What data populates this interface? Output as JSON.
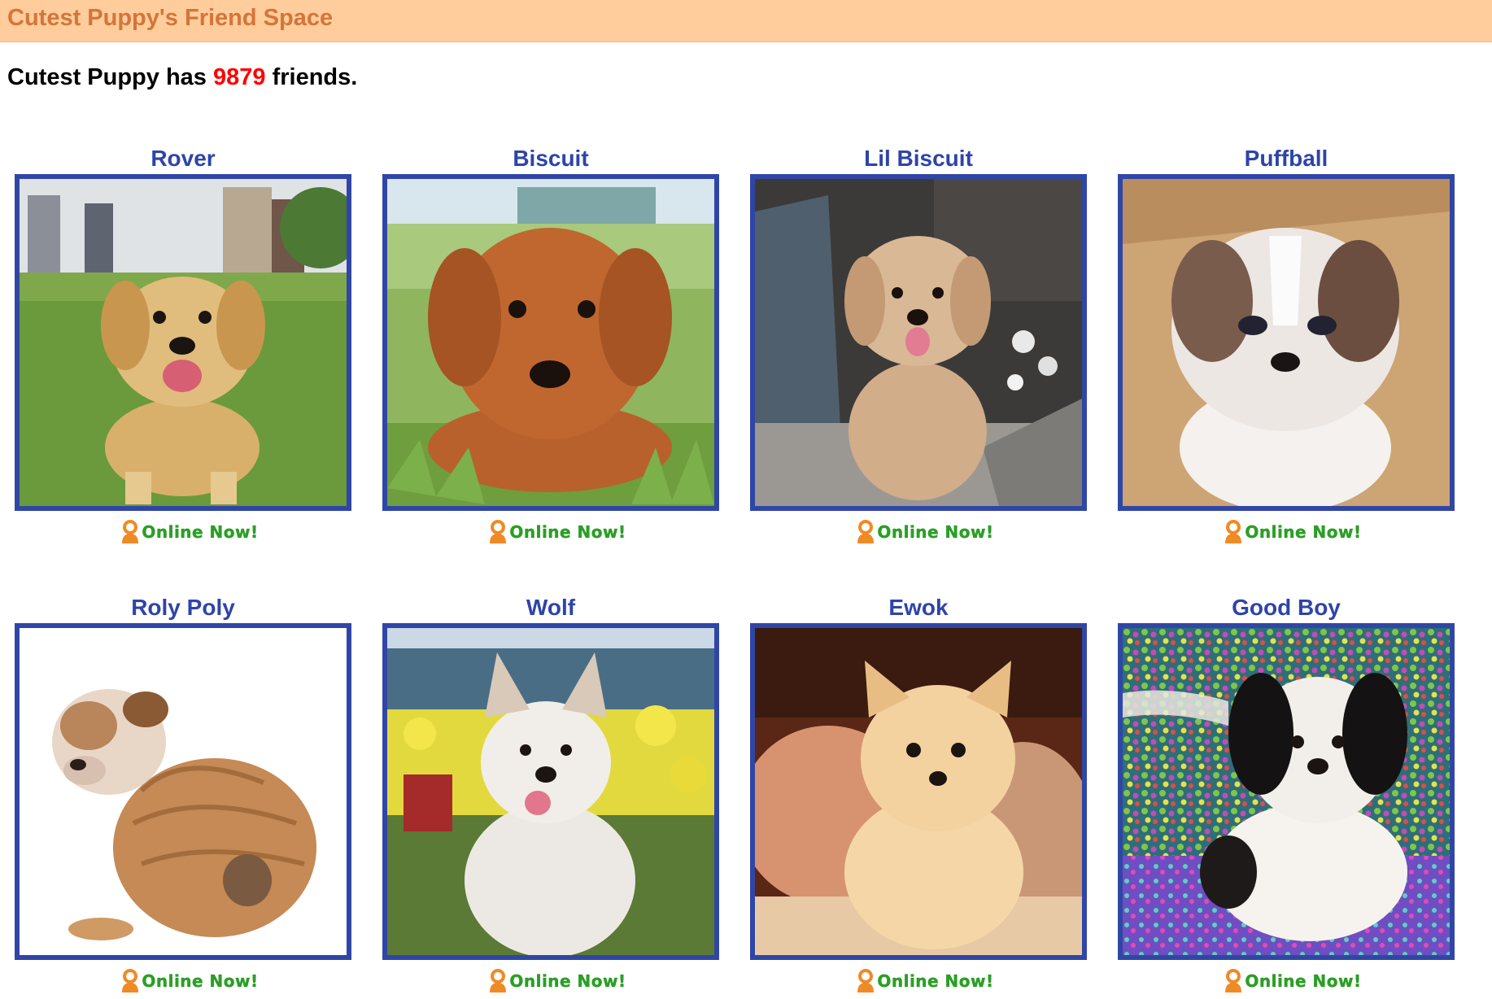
{
  "header": {
    "title": "Cutest Puppy's Friend Space",
    "bg_color": "#fecd9b",
    "title_color": "#d4753a"
  },
  "summary": {
    "prefix": "Cutest Puppy has",
    "count": "9879",
    "suffix": "friends."
  },
  "status_label": "Online Now!",
  "status_icon": "online-person-icon",
  "friends": [
    {
      "name": "Rover",
      "photo": "golden-retriever-puppy-photo"
    },
    {
      "name": "Biscuit",
      "photo": "red-cavapoo-puppy-photo"
    },
    {
      "name": "Lil Biscuit",
      "photo": "tan-maltipoo-puppy-photo"
    },
    {
      "name": "Puffball",
      "photo": "shih-tzu-puppy-photo"
    },
    {
      "name": "Roly Poly",
      "photo": "bulldog-puppy-photo"
    },
    {
      "name": "Wolf",
      "photo": "husky-puppy-photo"
    },
    {
      "name": "Ewok",
      "photo": "pomeranian-puppy-photo"
    },
    {
      "name": "Good Boy",
      "photo": "black-white-puppy-photo"
    }
  ],
  "colors": {
    "name_color": "#2e44a8",
    "frame_color": "#3046a6",
    "count_color": "#ff0000",
    "online_color": "#27a321"
  }
}
